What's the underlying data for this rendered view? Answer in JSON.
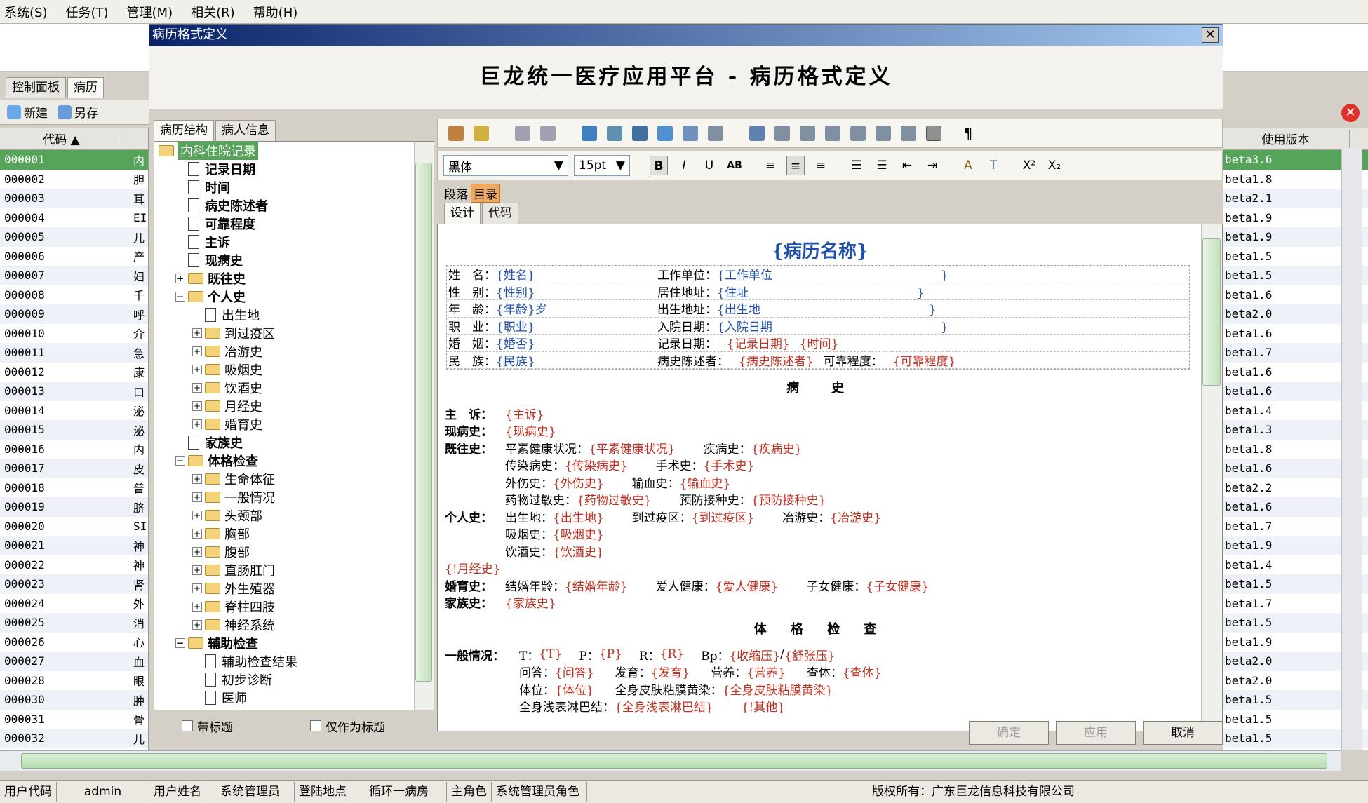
{
  "menu": [
    "系统(S)",
    "任务(T)",
    "管理(M)",
    "相关(R)",
    "帮助(H)"
  ],
  "main_tabs": [
    "控制面板",
    "病历"
  ],
  "left_toolbar": {
    "new": "新建",
    "saveas": "另存"
  },
  "grid": {
    "col_code": "代码 ▲",
    "rows": [
      [
        "000001",
        "内"
      ],
      [
        "000002",
        "胆"
      ],
      [
        "000003",
        "耳"
      ],
      [
        "000004",
        "EI"
      ],
      [
        "000005",
        "儿"
      ],
      [
        "000006",
        "产"
      ],
      [
        "000007",
        "妇"
      ],
      [
        "000008",
        "千"
      ],
      [
        "000009",
        "呼"
      ],
      [
        "000010",
        "介"
      ],
      [
        "000011",
        "急"
      ],
      [
        "000012",
        "康"
      ],
      [
        "000013",
        "口"
      ],
      [
        "000014",
        "泌"
      ],
      [
        "000015",
        "泌"
      ],
      [
        "000016",
        "内"
      ],
      [
        "000017",
        "皮"
      ],
      [
        "000018",
        "普"
      ],
      [
        "000019",
        "脐"
      ],
      [
        "000020",
        "SI"
      ],
      [
        "000021",
        "神"
      ],
      [
        "000022",
        "神"
      ],
      [
        "000023",
        "肾"
      ],
      [
        "000024",
        "外"
      ],
      [
        "000025",
        "消"
      ],
      [
        "000026",
        "心"
      ],
      [
        "000027",
        "血"
      ],
      [
        "000028",
        "眼"
      ],
      [
        "000030",
        "肿"
      ],
      [
        "000031",
        "骨"
      ],
      [
        "000032",
        "儿"
      ]
    ]
  },
  "right_grid": {
    "header": "使用版本",
    "rows": [
      "beta3.6",
      "beta1.8",
      "beta2.1",
      "beta1.9",
      "beta1.9",
      "beta1.5",
      "beta1.5",
      "beta1.6",
      "beta2.0",
      "beta1.6",
      "beta1.7",
      "beta1.6",
      "beta1.6",
      "beta1.4",
      "beta1.3",
      "beta1.8",
      "beta1.6",
      "beta2.2",
      "beta1.6",
      "beta1.7",
      "beta1.9",
      "beta1.4",
      "beta1.5",
      "beta1.7",
      "beta1.5",
      "beta1.9",
      "beta2.0",
      "beta2.0",
      "beta1.5",
      "beta1.5",
      "beta1.5"
    ]
  },
  "dialog": {
    "title": "病历格式定义",
    "close": "✕",
    "header": "巨龙统一医疗应用平台 - 病历格式定义",
    "left_tabs": [
      "病历结构",
      "病人信息"
    ],
    "tree": [
      {
        "label": "内科住院记录",
        "level": 0,
        "type": "folder-open",
        "sel": true
      },
      {
        "label": "记录日期",
        "level": 1,
        "type": "doc",
        "bold": true
      },
      {
        "label": "时间",
        "level": 1,
        "type": "doc",
        "bold": true
      },
      {
        "label": "病史陈述者",
        "level": 1,
        "type": "doc",
        "bold": true
      },
      {
        "label": "可靠程度",
        "level": 1,
        "type": "doc",
        "bold": true
      },
      {
        "label": "主诉",
        "level": 1,
        "type": "doc",
        "bold": true
      },
      {
        "label": "现病史",
        "level": 1,
        "type": "doc",
        "bold": true
      },
      {
        "label": "既往史",
        "level": 1,
        "type": "folder",
        "pm": "+",
        "bold": true
      },
      {
        "label": "个人史",
        "level": 1,
        "type": "folder",
        "pm": "−",
        "bold": true
      },
      {
        "label": "出生地",
        "level": 2,
        "type": "doc"
      },
      {
        "label": "到过疫区",
        "level": 2,
        "type": "folder",
        "pm": "+"
      },
      {
        "label": "冶游史",
        "level": 2,
        "type": "folder",
        "pm": "+"
      },
      {
        "label": "吸烟史",
        "level": 2,
        "type": "folder",
        "pm": "+"
      },
      {
        "label": "饮酒史",
        "level": 2,
        "type": "folder",
        "pm": "+"
      },
      {
        "label": "月经史",
        "level": 2,
        "type": "folder",
        "pm": "+"
      },
      {
        "label": "婚育史",
        "level": 2,
        "type": "folder",
        "pm": "+"
      },
      {
        "label": "家族史",
        "level": 1,
        "type": "doc",
        "bold": true
      },
      {
        "label": "体格检查",
        "level": 1,
        "type": "folder",
        "pm": "−",
        "bold": true
      },
      {
        "label": "生命体征",
        "level": 2,
        "type": "folder",
        "pm": "+"
      },
      {
        "label": "一般情况",
        "level": 2,
        "type": "folder",
        "pm": "+"
      },
      {
        "label": "头颈部",
        "level": 2,
        "type": "folder",
        "pm": "+"
      },
      {
        "label": "胸部",
        "level": 2,
        "type": "folder",
        "pm": "+"
      },
      {
        "label": "腹部",
        "level": 2,
        "type": "folder",
        "pm": "+"
      },
      {
        "label": "直肠肛门",
        "level": 2,
        "type": "folder",
        "pm": "+"
      },
      {
        "label": "外生殖器",
        "level": 2,
        "type": "folder",
        "pm": "+"
      },
      {
        "label": "脊柱四肢",
        "level": 2,
        "type": "folder",
        "pm": "+"
      },
      {
        "label": "神经系统",
        "level": 2,
        "type": "folder",
        "pm": "+"
      },
      {
        "label": "辅助检查",
        "level": 1,
        "type": "folder",
        "pm": "−",
        "bold": true
      },
      {
        "label": "辅助检查结果",
        "level": 2,
        "type": "doc"
      },
      {
        "label": "初步诊断",
        "level": 2,
        "type": "doc"
      },
      {
        "label": "医师",
        "level": 2,
        "type": "doc"
      }
    ],
    "check1": "带标题",
    "check2": "仅作为标题",
    "font": "黑体",
    "size": "15pt",
    "para_label": "段落",
    "para_value": "目录",
    "editor_tabs": [
      "设计",
      "代码"
    ],
    "buttons": {
      "ok": "确定",
      "apply": "应用",
      "cancel": "取消"
    },
    "doc": {
      "name": "{病历名称}",
      "info": [
        [
          "姓　名：",
          "{姓名",
          "}",
          "工作单位：",
          "{工作单位",
          "}"
        ],
        [
          "性　别：",
          "{性别}",
          "",
          "居住地址：",
          "{住址",
          "}"
        ],
        [
          "年　龄：",
          "{年龄}",
          "岁",
          "出生地址：",
          "{出生地",
          "}"
        ],
        [
          "职　业：",
          "{职业",
          "}",
          "入院日期：",
          "{入院日期",
          "}"
        ]
      ],
      "row5": [
        "婚　姻：",
        "{婚否",
        "}",
        "记录日期：",
        "{记录日期}",
        "{时间}"
      ],
      "row6": [
        "民　族：",
        "{民族",
        "}",
        "病史陈述者：",
        "{病史陈述者}",
        "可靠程度：",
        "{可靠程度}"
      ],
      "sec1": "病　史",
      "chief": [
        "主　诉：",
        "{主诉}"
      ],
      "present": [
        "现病史：",
        "{现病史}"
      ],
      "past": [
        [
          "既往史：",
          "平素健康状况：",
          "{平素健康状况}",
          "疾病史：",
          "{疾病史}"
        ],
        [
          "",
          "传染病史：",
          "{传染病史}",
          "手术史：",
          "{手术史}"
        ],
        [
          "",
          "外伤史：",
          "{外伤史}",
          "输血史：",
          "{输血史}"
        ],
        [
          "",
          "药物过敏史：",
          "{药物过敏史}",
          "预防接种史：",
          "{预防接种史}"
        ]
      ],
      "personal": [
        [
          "个人史：",
          "出生地：",
          "{出生地}",
          "到过疫区：",
          "{到过疫区}",
          "冶游史：",
          "{冶游史}"
        ],
        [
          "",
          "吸烟史：",
          "{吸烟史}"
        ],
        [
          "",
          "饮酒史：",
          "{饮酒史}"
        ]
      ],
      "menses": "{!月经史}",
      "marriage": [
        "婚育史：",
        "结婚年龄：",
        "{结婚年龄}",
        "爱人健康：",
        "{爱人健康}",
        "子女健康：",
        "{子女健康}"
      ],
      "family": [
        "家族史：",
        "{家族史}"
      ],
      "sec2": "体 格 检 查",
      "general": [
        "一般情况：",
        "T：",
        "{T}",
        "P：",
        "{P}",
        "R：",
        "{R}",
        "Bp：",
        "{收缩压}",
        "/",
        "{舒张压}"
      ],
      "g2": [
        "问答：",
        "{问答}",
        "发育：",
        "{发育}",
        "营养：",
        "{营养}",
        "查体：",
        "{查体}"
      ],
      "g3": [
        "体位：",
        "{体位}",
        "全身皮肤粘膜黄染：",
        "{全身皮肤粘膜黄染}"
      ],
      "g4": [
        "全身浅表淋巴结：",
        "{全身浅表淋巴结}",
        "{!其他}"
      ]
    }
  },
  "status": {
    "user_code_label": "用户代码",
    "user_code": "admin",
    "user_name_label": "用户姓名",
    "user_name": "系统管理员",
    "login_label": "登陆地点",
    "login": "循环一病房",
    "role_label": "主角色",
    "role": "系统管理员角色",
    "copyright": "版权所有：广东巨龙信息科技有限公司"
  }
}
